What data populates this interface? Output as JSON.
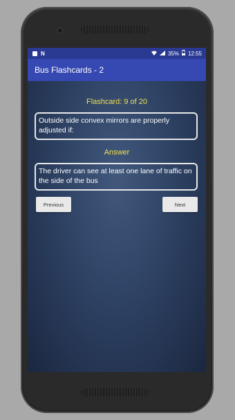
{
  "statusbar": {
    "battery_percent": "35%",
    "time": "12:55",
    "icons": [
      "image-icon",
      "n-icon",
      "wifi-icon",
      "signal-icon",
      "battery-icon"
    ]
  },
  "app": {
    "title": "Bus Flashcards - 2"
  },
  "flashcard": {
    "counter": "Flashcard: 9 of 20",
    "question": "Outside side convex mirrors are properly adjusted if:",
    "answer_label": "Answer",
    "answer": "The driver can see at least one lane of traffic on the side of the bus"
  },
  "buttons": {
    "previous": "Previous",
    "next": "Next"
  },
  "colors": {
    "appbar": "#3648b1",
    "statusbar": "#2a3a92",
    "accent_text": "#f2e04d"
  }
}
